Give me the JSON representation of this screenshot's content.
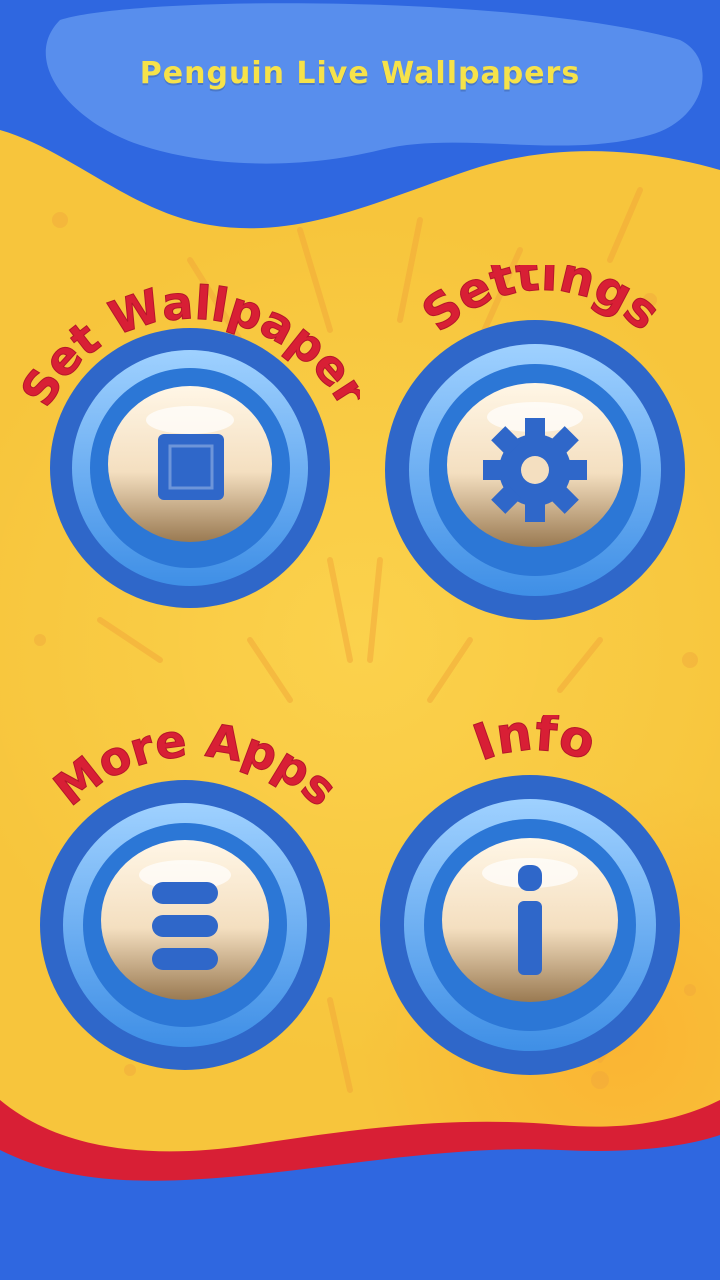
{
  "app": {
    "title": "Penguin Live Wallpapers"
  },
  "menu": {
    "set_wallpaper": {
      "label": "Set Wallpaper",
      "icon": "square-icon"
    },
    "settings": {
      "label": "Settings",
      "icon": "gear-icon"
    },
    "more_apps": {
      "label": "More Apps",
      "icon": "list-icon"
    },
    "info": {
      "label": "Info",
      "icon": "info-icon"
    }
  },
  "colors": {
    "background": "#f7c53c",
    "header_blue": "#2f67e0",
    "footer_red": "#d81f35",
    "label_red": "#d81f35",
    "title_yellow": "#f6e24a"
  }
}
